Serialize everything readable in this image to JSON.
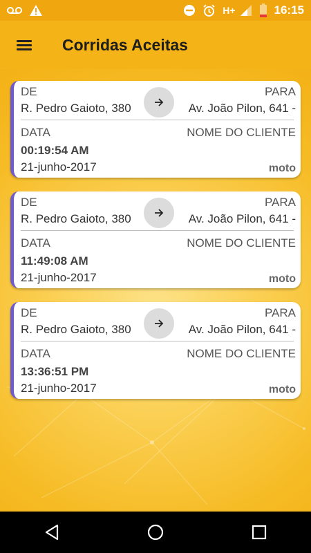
{
  "status_bar": {
    "time": "16:15",
    "network": "H+",
    "icons": [
      "voicemail-icon",
      "warning-icon",
      "do-not-disturb-icon",
      "alarm-icon",
      "signal-icon",
      "battery-low-icon"
    ]
  },
  "app_bar": {
    "title": "Corridas Aceitas",
    "menu_icon": "hamburger-menu-icon"
  },
  "cards": [
    {
      "from_label": "DE",
      "from_value": "R. Pedro Gaioto, 380",
      "to_label": "PARA",
      "to_value": "Av. João Pilon, 641 -",
      "date_label": "DATA",
      "client_label": "NOME DO CLIENTE",
      "time": "00:19:54 AM",
      "date": "21-junho-2017",
      "vehicle": "moto"
    },
    {
      "from_label": "DE",
      "from_value": "R. Pedro Gaioto, 380",
      "to_label": "PARA",
      "to_value": "Av. João Pilon, 641 -",
      "date_label": "DATA",
      "client_label": "NOME DO CLIENTE",
      "time": "11:49:08 AM",
      "date": "21-junho-2017",
      "vehicle": "moto"
    },
    {
      "from_label": "DE",
      "from_value": "R. Pedro Gaioto, 380",
      "to_label": "PARA",
      "to_value": "Av. João Pilon, 641 -",
      "date_label": "DATA",
      "client_label": "NOME DO CLIENTE",
      "time": "13:36:51 PM",
      "date": "21-junho-2017",
      "vehicle": "moto"
    }
  ],
  "colors": {
    "accent": "#6f5cc9",
    "app_bar": "#f4b317",
    "status_bar": "#f0a60e",
    "background": "#fbd055"
  },
  "nav_bar": {
    "icons": [
      "back-icon",
      "home-icon",
      "recents-icon"
    ]
  }
}
